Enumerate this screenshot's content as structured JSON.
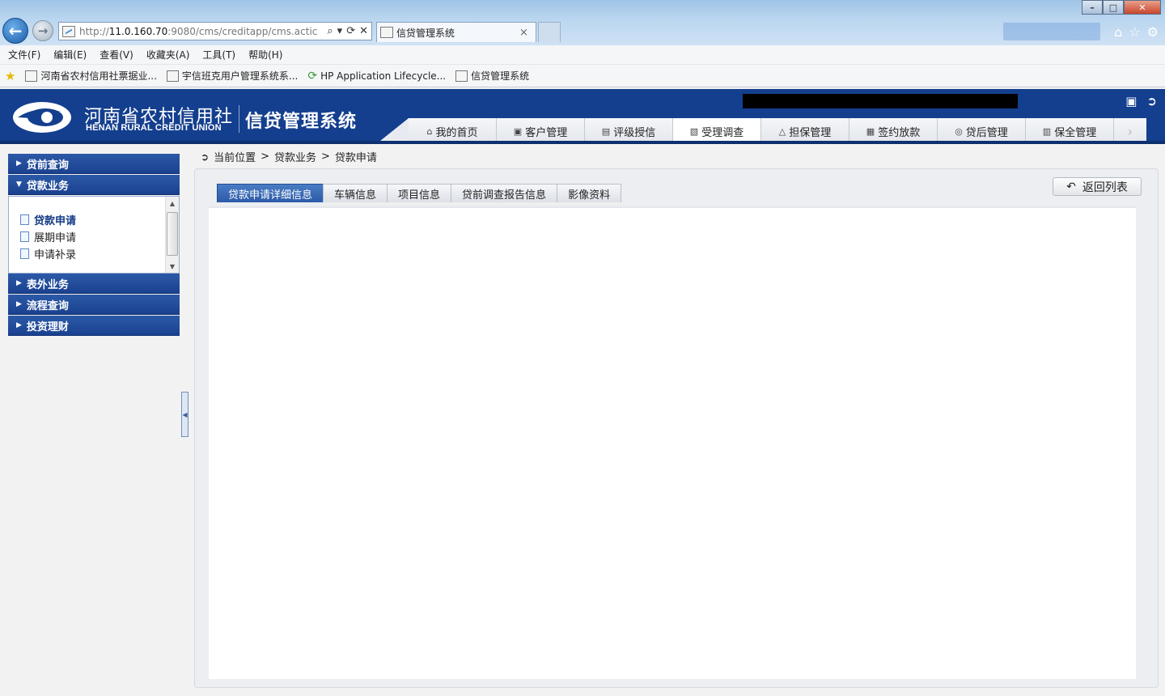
{
  "browser": {
    "url_prefix": "http://",
    "url_host": "11.0.160.70",
    "url_rest": ":9080/cms/creditapp/cms.actic",
    "tab_title": "信贷管理系统",
    "tab_close": "×",
    "tools": [
      "⌕",
      "▾",
      "⟳",
      "✕"
    ]
  },
  "menu": [
    "文件(F)",
    "编辑(E)",
    "查看(V)",
    "收藏夹(A)",
    "工具(T)",
    "帮助(H)"
  ],
  "favorites": [
    "河南省农村信用社票据业...",
    "宇信班克用户管理系统系...",
    "HP Application Lifecycle...",
    "信贷管理系统"
  ],
  "header": {
    "org_cn": "河南省农村信用社",
    "org_en": "HENAN RURAL CREDIT UNION",
    "system_name": "信贷管理系统"
  },
  "nav": [
    {
      "label": "我的首页",
      "icon": "home-icon",
      "glyph": "⌂"
    },
    {
      "label": "客户管理",
      "icon": "customer-icon",
      "glyph": "▣"
    },
    {
      "label": "评级授信",
      "icon": "rating-icon",
      "glyph": "▤"
    },
    {
      "label": "受理调查",
      "icon": "survey-icon",
      "glyph": "▧",
      "active": true
    },
    {
      "label": "担保管理",
      "icon": "guarantee-icon",
      "glyph": "△"
    },
    {
      "label": "签约放款",
      "icon": "contract-icon",
      "glyph": "▦"
    },
    {
      "label": "贷后管理",
      "icon": "postloan-icon",
      "glyph": "◎"
    },
    {
      "label": "保全管理",
      "icon": "preserve-icon",
      "glyph": "▥"
    }
  ],
  "sidebar": {
    "sections": [
      "贷前查询",
      "贷款业务",
      "表外业务",
      "流程查询",
      "投资理财"
    ],
    "loan_items": [
      "贷款申请",
      "展期申请",
      "申请补录"
    ]
  },
  "breadcrumb": {
    "label": "当前位置",
    "sep": ">",
    "level1": "贷款业务",
    "level2": "贷款申请"
  },
  "subtabs": [
    "贷款申请详细信息",
    "车辆信息",
    "项目信息",
    "贷前调查报告信息",
    "影像资料"
  ],
  "back_button": "返回列表",
  "colors": {
    "header_bg": "#143f8e",
    "sidebar_head": "#2c5aa8",
    "active_subtab": "#2c5aa8"
  }
}
